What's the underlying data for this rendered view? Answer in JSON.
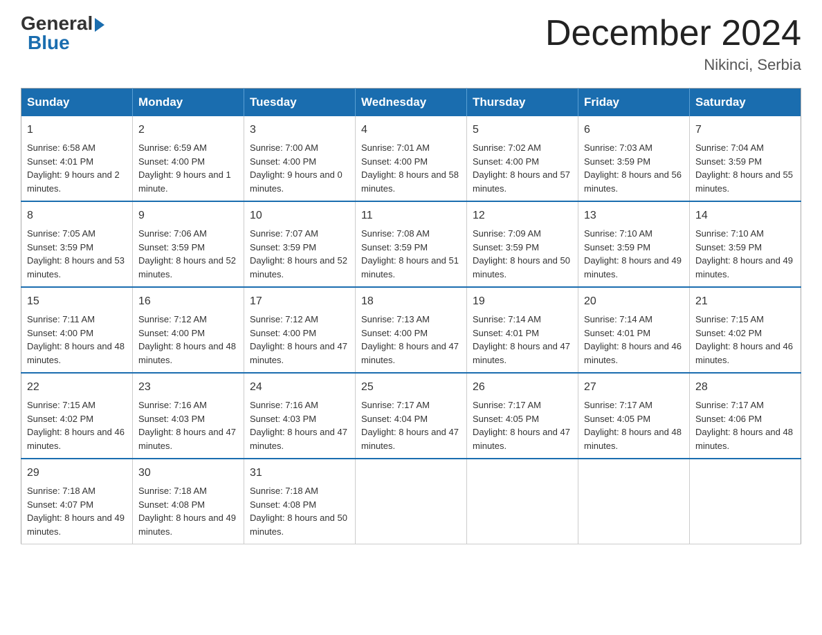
{
  "logo": {
    "general": "General",
    "blue": "Blue"
  },
  "header": {
    "title": "December 2024",
    "location": "Nikinci, Serbia"
  },
  "days_of_week": [
    "Sunday",
    "Monday",
    "Tuesday",
    "Wednesday",
    "Thursday",
    "Friday",
    "Saturday"
  ],
  "weeks": [
    [
      {
        "day": "1",
        "sunrise": "6:58 AM",
        "sunset": "4:01 PM",
        "daylight": "9 hours and 2 minutes."
      },
      {
        "day": "2",
        "sunrise": "6:59 AM",
        "sunset": "4:00 PM",
        "daylight": "9 hours and 1 minute."
      },
      {
        "day": "3",
        "sunrise": "7:00 AM",
        "sunset": "4:00 PM",
        "daylight": "9 hours and 0 minutes."
      },
      {
        "day": "4",
        "sunrise": "7:01 AM",
        "sunset": "4:00 PM",
        "daylight": "8 hours and 58 minutes."
      },
      {
        "day": "5",
        "sunrise": "7:02 AM",
        "sunset": "4:00 PM",
        "daylight": "8 hours and 57 minutes."
      },
      {
        "day": "6",
        "sunrise": "7:03 AM",
        "sunset": "3:59 PM",
        "daylight": "8 hours and 56 minutes."
      },
      {
        "day": "7",
        "sunrise": "7:04 AM",
        "sunset": "3:59 PM",
        "daylight": "8 hours and 55 minutes."
      }
    ],
    [
      {
        "day": "8",
        "sunrise": "7:05 AM",
        "sunset": "3:59 PM",
        "daylight": "8 hours and 53 minutes."
      },
      {
        "day": "9",
        "sunrise": "7:06 AM",
        "sunset": "3:59 PM",
        "daylight": "8 hours and 52 minutes."
      },
      {
        "day": "10",
        "sunrise": "7:07 AM",
        "sunset": "3:59 PM",
        "daylight": "8 hours and 52 minutes."
      },
      {
        "day": "11",
        "sunrise": "7:08 AM",
        "sunset": "3:59 PM",
        "daylight": "8 hours and 51 minutes."
      },
      {
        "day": "12",
        "sunrise": "7:09 AM",
        "sunset": "3:59 PM",
        "daylight": "8 hours and 50 minutes."
      },
      {
        "day": "13",
        "sunrise": "7:10 AM",
        "sunset": "3:59 PM",
        "daylight": "8 hours and 49 minutes."
      },
      {
        "day": "14",
        "sunrise": "7:10 AM",
        "sunset": "3:59 PM",
        "daylight": "8 hours and 49 minutes."
      }
    ],
    [
      {
        "day": "15",
        "sunrise": "7:11 AM",
        "sunset": "4:00 PM",
        "daylight": "8 hours and 48 minutes."
      },
      {
        "day": "16",
        "sunrise": "7:12 AM",
        "sunset": "4:00 PM",
        "daylight": "8 hours and 48 minutes."
      },
      {
        "day": "17",
        "sunrise": "7:12 AM",
        "sunset": "4:00 PM",
        "daylight": "8 hours and 47 minutes."
      },
      {
        "day": "18",
        "sunrise": "7:13 AM",
        "sunset": "4:00 PM",
        "daylight": "8 hours and 47 minutes."
      },
      {
        "day": "19",
        "sunrise": "7:14 AM",
        "sunset": "4:01 PM",
        "daylight": "8 hours and 47 minutes."
      },
      {
        "day": "20",
        "sunrise": "7:14 AM",
        "sunset": "4:01 PM",
        "daylight": "8 hours and 46 minutes."
      },
      {
        "day": "21",
        "sunrise": "7:15 AM",
        "sunset": "4:02 PM",
        "daylight": "8 hours and 46 minutes."
      }
    ],
    [
      {
        "day": "22",
        "sunrise": "7:15 AM",
        "sunset": "4:02 PM",
        "daylight": "8 hours and 46 minutes."
      },
      {
        "day": "23",
        "sunrise": "7:16 AM",
        "sunset": "4:03 PM",
        "daylight": "8 hours and 47 minutes."
      },
      {
        "day": "24",
        "sunrise": "7:16 AM",
        "sunset": "4:03 PM",
        "daylight": "8 hours and 47 minutes."
      },
      {
        "day": "25",
        "sunrise": "7:17 AM",
        "sunset": "4:04 PM",
        "daylight": "8 hours and 47 minutes."
      },
      {
        "day": "26",
        "sunrise": "7:17 AM",
        "sunset": "4:05 PM",
        "daylight": "8 hours and 47 minutes."
      },
      {
        "day": "27",
        "sunrise": "7:17 AM",
        "sunset": "4:05 PM",
        "daylight": "8 hours and 48 minutes."
      },
      {
        "day": "28",
        "sunrise": "7:17 AM",
        "sunset": "4:06 PM",
        "daylight": "8 hours and 48 minutes."
      }
    ],
    [
      {
        "day": "29",
        "sunrise": "7:18 AM",
        "sunset": "4:07 PM",
        "daylight": "8 hours and 49 minutes."
      },
      {
        "day": "30",
        "sunrise": "7:18 AM",
        "sunset": "4:08 PM",
        "daylight": "8 hours and 49 minutes."
      },
      {
        "day": "31",
        "sunrise": "7:18 AM",
        "sunset": "4:08 PM",
        "daylight": "8 hours and 50 minutes."
      },
      null,
      null,
      null,
      null
    ]
  ]
}
